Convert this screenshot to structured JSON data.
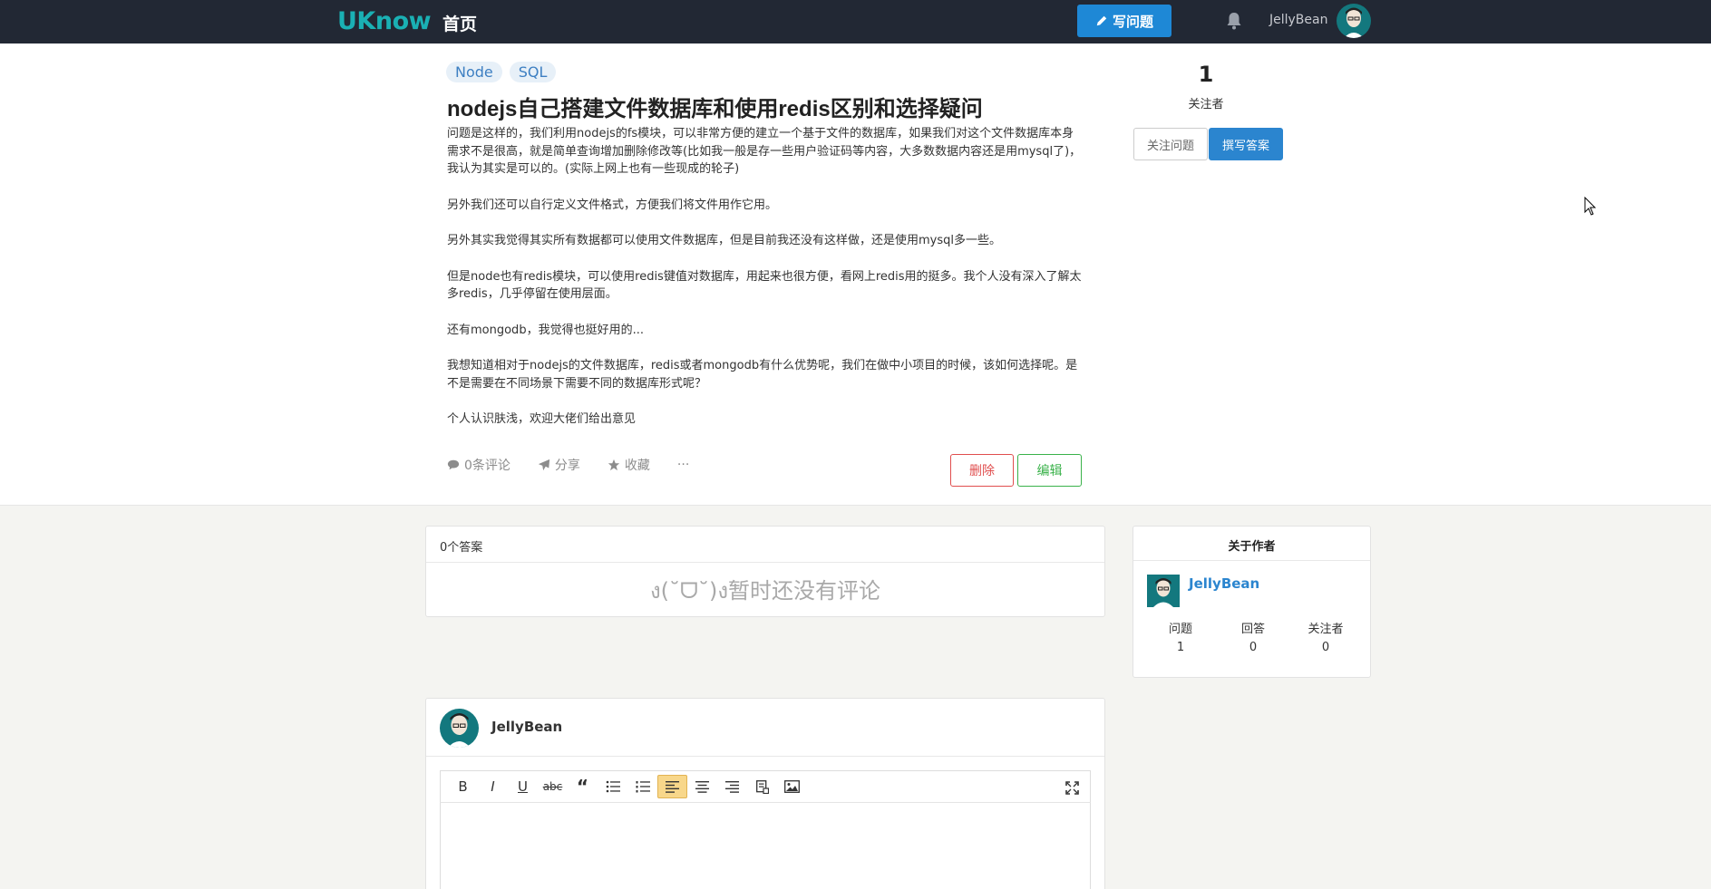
{
  "nav": {
    "logo": "UKnow",
    "home": "首页",
    "ask_label": "写问题",
    "username": "JellyBean"
  },
  "question": {
    "tags": [
      "Node",
      "SQL"
    ],
    "title": "nodejs自己搭建文件数据库和使用redis区别和选择疑问",
    "paragraphs": [
      "问题是这样的，我们利用nodejs的fs模块，可以非常方便的建立一个基于文件的数据库，如果我们对这个文件数据库本身需求不是很高，就是简单查询增加删除修改等(比如我一般是存一些用户验证码等内容，大多数数据内容还是用mysql了)，我认为其实是可以的。(实际上网上也有一些现成的轮子)",
      "另外我们还可以自行定义文件格式，方便我们将文件用作它用。",
      "另外其实我觉得其实所有数据都可以使用文件数据库，但是目前我还没有这样做，还是使用mysql多一些。",
      "但是node也有redis模块，可以使用redis键值对数据库，用起来也很方便，看网上redis用的挺多。我个人没有深入了解太多redis，几乎停留在使用层面。",
      "还有mongodb，我觉得也挺好用的...",
      "我想知道相对于nodejs的文件数据库，redis或者mongodb有什么优势呢，我们在做中小项目的时候，该如何选择呢。是不是需要在不同场景下需要不同的数据库形式呢？",
      "个人认识肤浅，欢迎大佬们给出意见"
    ],
    "actions": {
      "comments": "0条评论",
      "share": "分享",
      "collect": "收藏",
      "more": "···"
    },
    "delete_label": "删除",
    "edit_label": "编辑"
  },
  "follow": {
    "count": "1",
    "label": "关注者",
    "follow_btn": "关注问题",
    "answer_btn": "撰写答案"
  },
  "answers": {
    "header": "0个答案",
    "empty": "ง(˘ᗜ˘)ง暂时还没有评论"
  },
  "author": {
    "header": "关于作者",
    "name": "JellyBean",
    "stats": [
      {
        "label": "问题",
        "value": "1"
      },
      {
        "label": "回答",
        "value": "0"
      },
      {
        "label": "关注者",
        "value": "0"
      }
    ]
  },
  "editor": {
    "username": "JellyBean",
    "toolbar": [
      "B",
      "I",
      "U",
      "abc",
      "“",
      "list-ul",
      "list-ol",
      "align-left",
      "align-center",
      "align-right",
      "code-block",
      "image"
    ],
    "active": "align-left"
  },
  "colors": {
    "nav_bg": "#222834",
    "logo": "#1ab0b4",
    "primary": "#2b85cf",
    "danger": "#e04e4e",
    "success": "#3ab24a"
  }
}
